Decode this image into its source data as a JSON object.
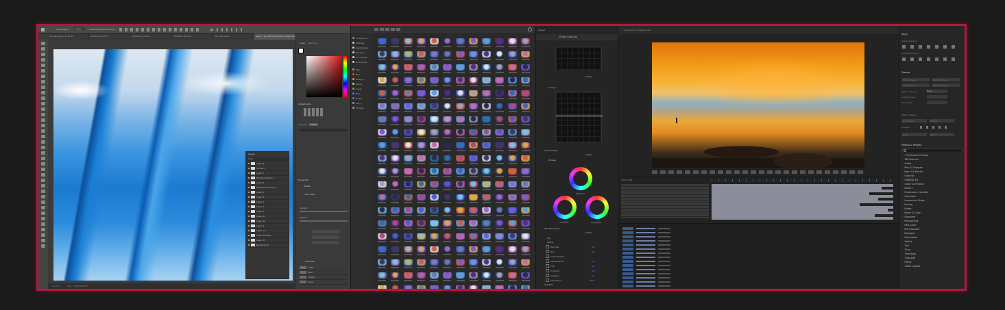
{
  "photoshop": {
    "options_bar": {
      "auto_select_label": "Auto-Select:",
      "layer_dropdown": "Layer",
      "transform_controls_label": "Show Transform Controls"
    },
    "tabs": [
      {
        "label": "PS_Glaciar.psd @ 16.7%",
        "active": false
      },
      {
        "label": "Untitled-1 @ 50%",
        "active": false
      },
      {
        "label": "Untitled-2 @ 50%",
        "active": false
      },
      {
        "label": "Untitled-3 @ 50%",
        "active": false
      },
      {
        "label": "DSC_0001.psd",
        "active": false
      },
      {
        "label": "Layer 7 @ 16.7% (Curves 1, Layer Mask/8)",
        "active": true
      }
    ],
    "status": {
      "zoom": "16.67%",
      "doc": "Doc: 7.95M/198.0M"
    },
    "panels": {
      "color_tab": "Color",
      "swatches_tab": "Swatches",
      "adjustments": "Adjustments",
      "libraries": "Libraries",
      "styles": "Styles",
      "properties": "Properties",
      "masks": "Masks",
      "layer_mask": "Layer Mask",
      "density": "Density",
      "feather": "Feather",
      "channels": "Channels",
      "channel_names": [
        "RGB",
        "Red",
        "Green",
        "Blue"
      ]
    },
    "layers_panel": {
      "title": "Layers",
      "kind_label": "Kind",
      "layers": [
        "Layer 8",
        "Curves 1",
        "Layer 7",
        "Hue/Saturation 1",
        "Layer 6",
        "Background copy 2",
        "Layer 5",
        "Layer 4",
        "Layer 3",
        "Layer 2",
        "Layer 1",
        "Layer 11",
        "Layer 10",
        "Layer 9",
        "Layer 12",
        "Layer Shadow",
        "Layer 13",
        "Background"
      ]
    }
  },
  "lightroom": {
    "sidebar": [
      {
        "label": "Collections",
        "color": "#6a8fd8"
      },
      {
        "label": "Settings",
        "color": "#d0d0d0"
      },
      {
        "label": "Applications",
        "color": "#d0d0d0"
      },
      {
        "label": "Desktop",
        "color": "#d0d0d0"
      },
      {
        "label": "Documents",
        "color": "#d0d0d0"
      },
      {
        "label": "Downloads",
        "color": "#d0d0d0"
      },
      {
        "label": "Tags",
        "color": "#999999"
      },
      {
        "label": "Red",
        "color": "#e04848"
      },
      {
        "label": "Orange",
        "color": "#e8913a"
      },
      {
        "label": "Yellow",
        "color": "#e8d23a"
      },
      {
        "label": "Green",
        "color": "#4ac04a"
      },
      {
        "label": "Blue",
        "color": "#4a7ae8"
      },
      {
        "label": "Purple",
        "color": "#a34ae8"
      },
      {
        "label": "Gray",
        "color": "#9a9a9a"
      },
      {
        "label": "All Tags",
        "color": "#9a9a9a"
      }
    ],
    "thumbnail_count": 252
  },
  "effect_controls": {
    "project_tab": "Project",
    "title": "Effect Controls",
    "active_label": "Active",
    "sections": {
      "curves": "Curves",
      "color_wheels": "Color Wheels",
      "wheels": "Wheels",
      "hsl_secondary": "HSL Secondary",
      "key": "Key",
      "refine": "Refine",
      "correction": "Correction",
      "vignette": "Vignette"
    },
    "wheel_labels": [
      "Midtones",
      "Shadows",
      "Highlights"
    ],
    "rows": [
      {
        "label": "Denoise",
        "value": "0.0"
      },
      {
        "label": "Blur",
        "value": "0.0"
      },
      {
        "label": "Color Wheels",
        "value": ""
      },
      {
        "label": "Temperature",
        "value": "0.0"
      },
      {
        "label": "Tint",
        "value": "0.0"
      },
      {
        "label": "Contrast",
        "value": "0.0"
      },
      {
        "label": "Sharpen",
        "value": "0.0"
      },
      {
        "label": "Saturation",
        "value": "100.0"
      }
    ]
  },
  "after_effects": {
    "comp_name": "Composition: Sunset_Lake",
    "timecode": "0:00:12:08",
    "timeline_bar_fractions": [
      0.98,
      0.92,
      0.98,
      0.85,
      0.98,
      0.9,
      0.98,
      0.8,
      0.98,
      0.95,
      0.98,
      0.88,
      0.98
    ],
    "project_rows": 15
  },
  "right_panels": {
    "align_title": "Align",
    "align_layers_to": "Align Layers to:",
    "distribute_layers": "Distribute Layers:",
    "tracker_title": "Tracker",
    "track_camera": "Track Camera",
    "warp_stabilizer": "Warp Stabilizer",
    "track_motion": "Track Motion",
    "stabilize_motion": "Stabilize Motion",
    "motion_source": "Motion Source:",
    "motion_source_value": "None",
    "current_track": "Current Track:",
    "track_type": "Track Type:",
    "motion_target": "Motion Target:",
    "edit_target": "Edit Target...",
    "options": "Options...",
    "analyze": "Analyze:",
    "reset": "Reset",
    "apply": "Apply",
    "effects_title": "Effects & Presets",
    "effects": [
      "* Animation Presets",
      "3D Channel",
      "Audio",
      "Blur & Sharpen",
      "Boris FX Mocha",
      "Channel",
      "CINEMA 4D",
      "Color Correction",
      "Distort",
      "Expression Controls",
      "Generate",
      "Immersive Video",
      "Keying",
      "Matte",
      "Noise & Grain",
      "Obsolete",
      "Perspective",
      "Red Giant",
      "RG Trapcode",
      "Rowbyte",
      "Simulation",
      "Stylize",
      "Text",
      "Time",
      "Transition",
      "Trapcode",
      "Utility",
      "Video Copilot"
    ]
  }
}
